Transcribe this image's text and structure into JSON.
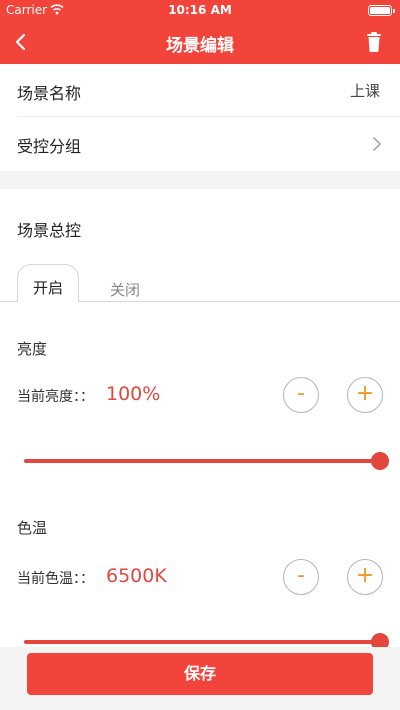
{
  "status_bar": {
    "carrier": "Carrier",
    "time": "10:16 AM"
  },
  "nav": {
    "title": "场景编辑"
  },
  "scene_name": {
    "label": "场景名称",
    "value": "上课"
  },
  "group": {
    "label": "受控分组"
  },
  "master": {
    "title": "场景总控"
  },
  "tabs": [
    {
      "label": "开启",
      "active": true
    },
    {
      "label": "关闭",
      "active": false
    }
  ],
  "brightness": {
    "title": "亮度",
    "current_label": "当前亮度：：",
    "value": "100%",
    "minus": "-",
    "plus": "+",
    "level_fraction": 1.0
  },
  "color_temp": {
    "title": "色温",
    "current_label": "当前色温：：",
    "value": "6500K",
    "minus": "-",
    "plus": "+",
    "level_fraction": 1.0
  },
  "footer": {
    "save_label": "保存"
  },
  "colors": {
    "accent": "#f2443a",
    "value_text": "#e2483f",
    "button_glyph": "#ef9a24"
  }
}
